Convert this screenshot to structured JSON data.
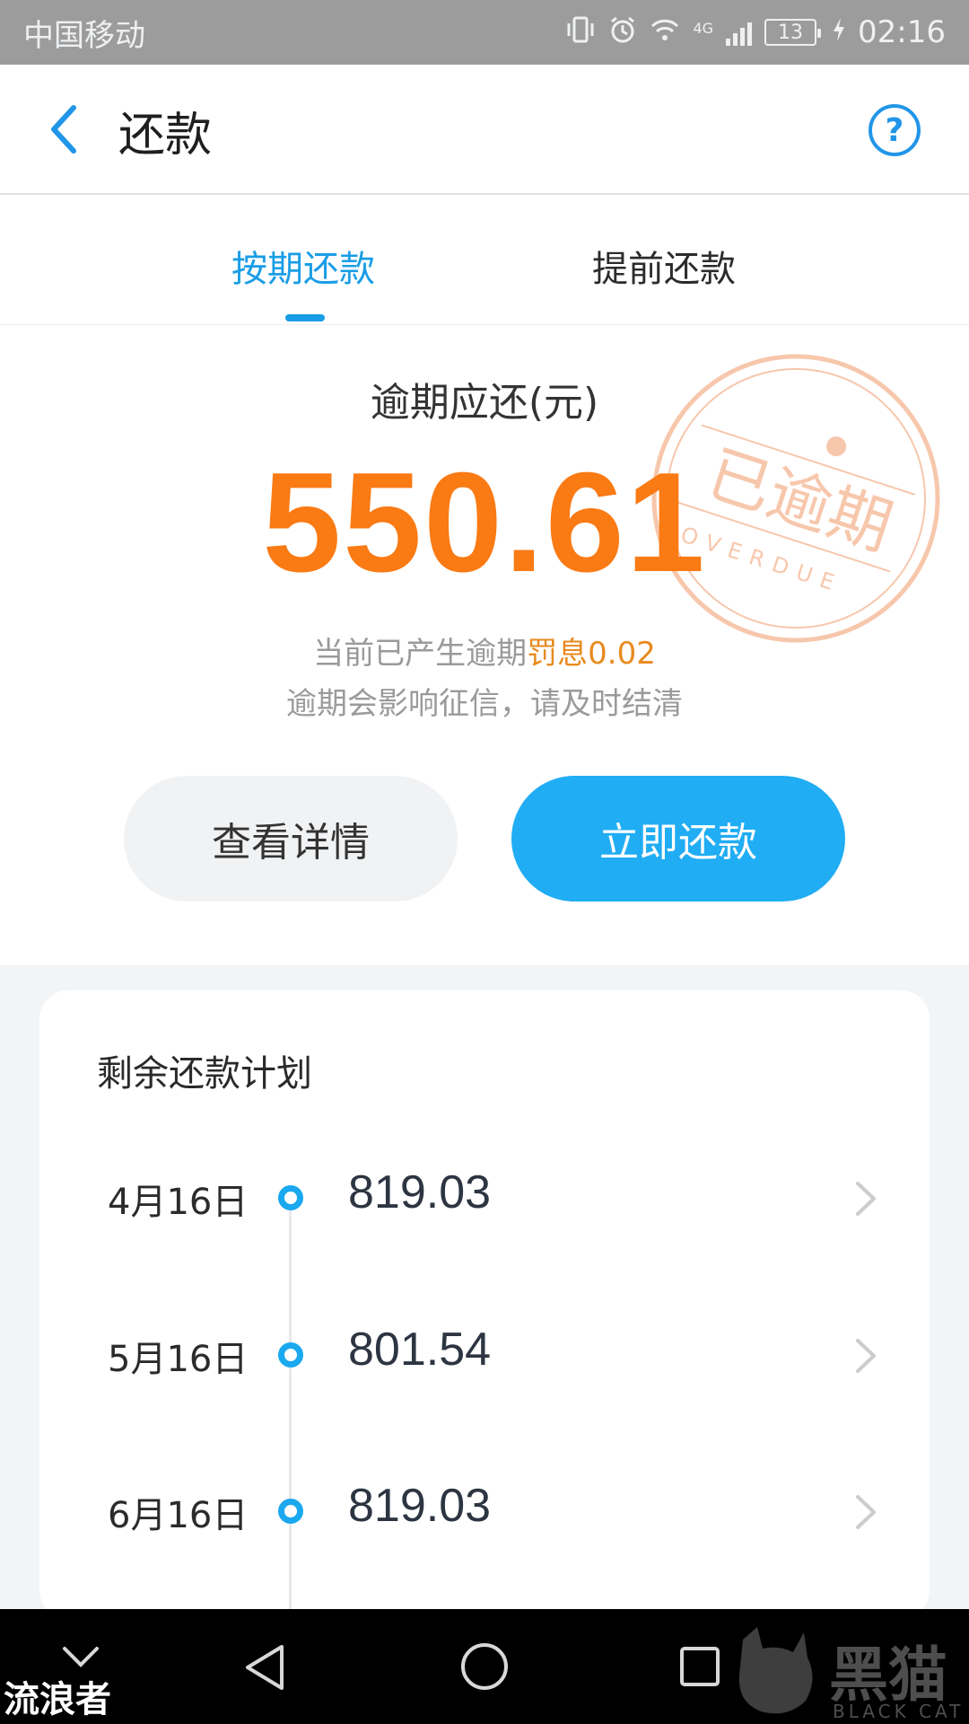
{
  "status_bar": {
    "carrier": "中国移动",
    "network": "4G",
    "battery": "13",
    "time": "02:16"
  },
  "header": {
    "title": "还款",
    "back_icon": "chevron-left-icon",
    "help_icon": "question-circle-icon",
    "help_glyph": "?"
  },
  "tabs": [
    {
      "label": "按期还款",
      "active": true
    },
    {
      "label": "提前还款",
      "active": false
    }
  ],
  "summary": {
    "label": "逾期应还(元)",
    "amount": "550.61",
    "penalty_prefix": "当前已产生逾期",
    "penalty_highlight": "罚息0.02",
    "warning": "逾期会影响征信，请及时结清",
    "stamp_text": "已逾期",
    "stamp_sub": "OVERDUE",
    "details_button": "查看详情",
    "pay_button": "立即还款"
  },
  "plan": {
    "title": "剩余还款计划",
    "rows": [
      {
        "date": "4月16日",
        "amount": "819.03"
      },
      {
        "date": "5月16日",
        "amount": "801.54"
      },
      {
        "date": "6月16日",
        "amount": "819.03"
      }
    ]
  },
  "nav_bar": {
    "items": [
      "chevron-down-icon",
      "back-triangle-icon",
      "home-circle-icon",
      "recent-square-icon"
    ]
  },
  "watermarks": {
    "left": "流浪者",
    "right": "黑猫",
    "right_sub": "BLACK CAT"
  },
  "colors": {
    "accent": "#1a9de6",
    "primary_button": "#20adf4",
    "amount": "#fa7a14",
    "penalty": "#e88a1e",
    "stamp": "#f19a6a"
  }
}
